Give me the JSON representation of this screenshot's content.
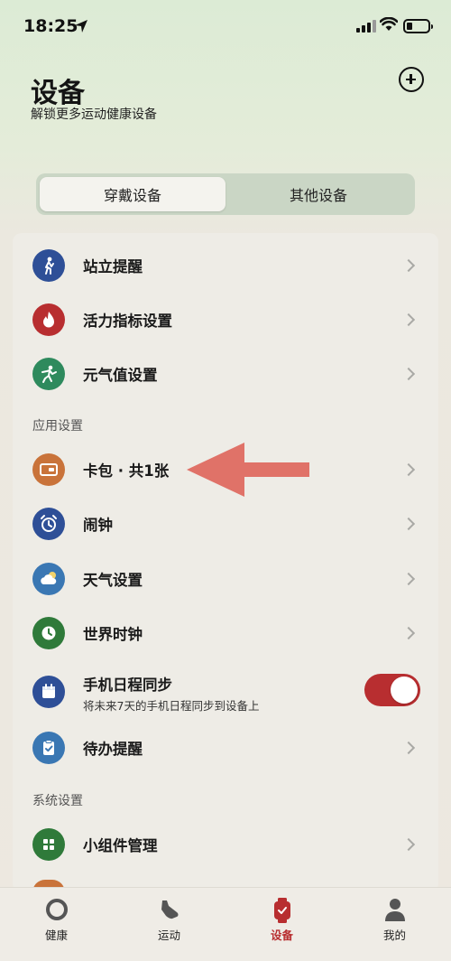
{
  "status": {
    "time": "18:25"
  },
  "header": {
    "title": "设备",
    "subtitle": "解锁更多运动健康设备"
  },
  "segments": [
    {
      "label": "穿戴设备",
      "active": true
    },
    {
      "label": "其他设备",
      "active": false
    }
  ],
  "rows": [
    {
      "label": "站立提醒",
      "icon": "stand-icon",
      "color": "#2e4f97"
    },
    {
      "label": "活力指标设置",
      "icon": "flame-icon",
      "color": "#b82e30"
    },
    {
      "label": "元气值设置",
      "icon": "energy-icon",
      "color": "#2e8a5d"
    }
  ],
  "app_settings": {
    "header": "应用设置",
    "rows": [
      {
        "label": "卡包 · 共1张",
        "icon": "card-icon",
        "color": "#c9733a"
      },
      {
        "label": "闹钟",
        "icon": "alarm-icon",
        "color": "#2e4f97"
      },
      {
        "label": "天气设置",
        "icon": "weather-icon",
        "color": "#3a77b3"
      },
      {
        "label": "世界时钟",
        "icon": "clock-icon",
        "color": "#2f7a3a"
      },
      {
        "label": "手机日程同步",
        "sub": "将未来7天的手机日程同步到设备上",
        "icon": "calendar-icon",
        "color": "#2e4f97",
        "toggle": true
      },
      {
        "label": "待办提醒",
        "icon": "todo-icon",
        "color": "#3a77b3"
      }
    ]
  },
  "system_settings": {
    "header": "系统设置",
    "rows": [
      {
        "label": "小组件管理",
        "icon": "widget-icon",
        "color": "#2f7a3a"
      }
    ]
  },
  "tabs": [
    {
      "label": "健康",
      "icon": "health-ring-icon",
      "active": false
    },
    {
      "label": "运动",
      "icon": "shoe-icon",
      "active": false
    },
    {
      "label": "设备",
      "icon": "watch-icon",
      "active": true
    },
    {
      "label": "我的",
      "icon": "person-icon",
      "active": false
    }
  ],
  "colors": {
    "accent": "#b82e30",
    "arrow": "#e07268"
  }
}
